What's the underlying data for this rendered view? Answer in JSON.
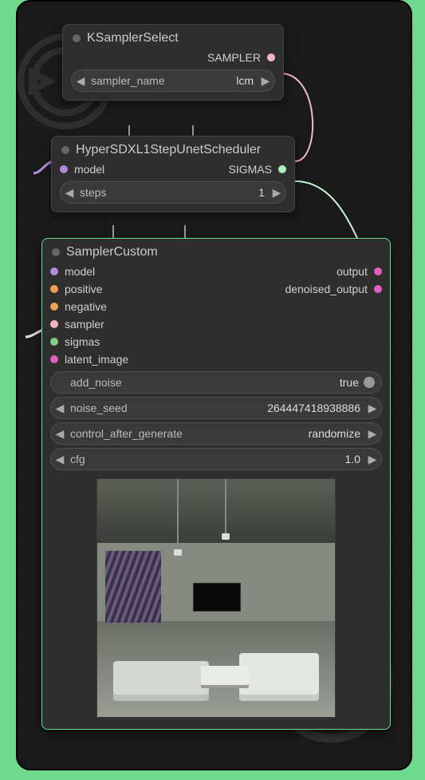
{
  "node1": {
    "title": "KSamplerSelect",
    "output_label": "SAMPLER",
    "widgets": {
      "sampler_name": {
        "label": "sampler_name",
        "value": "lcm"
      }
    }
  },
  "node2": {
    "title": "HyperSDXL1StepUnetScheduler",
    "inputs": {
      "model": "model"
    },
    "output_label": "SIGMAS",
    "widgets": {
      "steps": {
        "label": "steps",
        "value": "1"
      }
    }
  },
  "node3": {
    "title": "SamplerCustom",
    "inputs": {
      "model": "model",
      "positive": "positive",
      "negative": "negative",
      "sampler": "sampler",
      "sigmas": "sigmas",
      "latent_image": "latent_image"
    },
    "outputs": {
      "output": "output",
      "denoised_output": "denoised_output"
    },
    "widgets": {
      "add_noise": {
        "label": "add_noise",
        "value": "true"
      },
      "noise_seed": {
        "label": "noise_seed",
        "value": "264447418938886"
      },
      "control_after_generate": {
        "label": "control_after_generate",
        "value": "randomize"
      },
      "cfg": {
        "label": "cfg",
        "value": "1.0"
      }
    }
  }
}
